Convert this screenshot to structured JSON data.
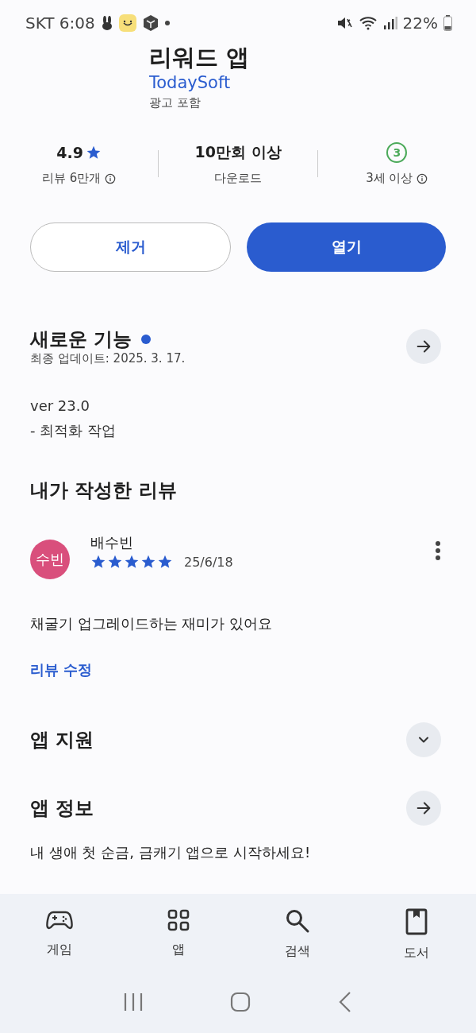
{
  "status_bar": {
    "carrier_time": "SKT 6:08",
    "battery": "22%"
  },
  "app": {
    "title": "리워드 앱",
    "developer": "TodaySoft",
    "ads_note": "광고 포함"
  },
  "stats": [
    {
      "kind": "rating",
      "value": "4.9",
      "label": "리뷰 6만개",
      "info": true
    },
    {
      "kind": "text",
      "value": "10만회 이상",
      "label": "다운로드",
      "info": false
    },
    {
      "kind": "age",
      "value": "3",
      "label": "3세 이상",
      "info": true
    }
  ],
  "buttons": [
    {
      "label": "제거",
      "kind": "outline"
    },
    {
      "label": "열기",
      "kind": "filled"
    }
  ],
  "whats_new": {
    "title": "새로운 기능",
    "new": true,
    "updated": "최종 업데이트: 2025. 3. 17.",
    "notes": [
      "ver 23.0",
      "- 최적화 작업"
    ]
  },
  "my_review": {
    "title": "내가 작성한 리뷰",
    "avatar": "수빈",
    "name": "배수빈",
    "stars": 5,
    "date": "25/6/18",
    "text": "채굴기 업그레이드하는 재미가 있어요",
    "edit_link": "리뷰 수정"
  },
  "sections": [
    {
      "title": "앱 지원",
      "kind": "expand",
      "expanded": false
    },
    {
      "title": "앱 정보",
      "kind": "arrow",
      "description": "내 생애 첫 순금, 금캐기 앱으로 시작하세요!"
    }
  ],
  "bottom_nav": [
    {
      "label": "게임",
      "selected": false
    },
    {
      "label": "앱",
      "selected": false
    },
    {
      "label": "검색",
      "selected": false
    },
    {
      "label": "도서",
      "selected": false
    }
  ]
}
